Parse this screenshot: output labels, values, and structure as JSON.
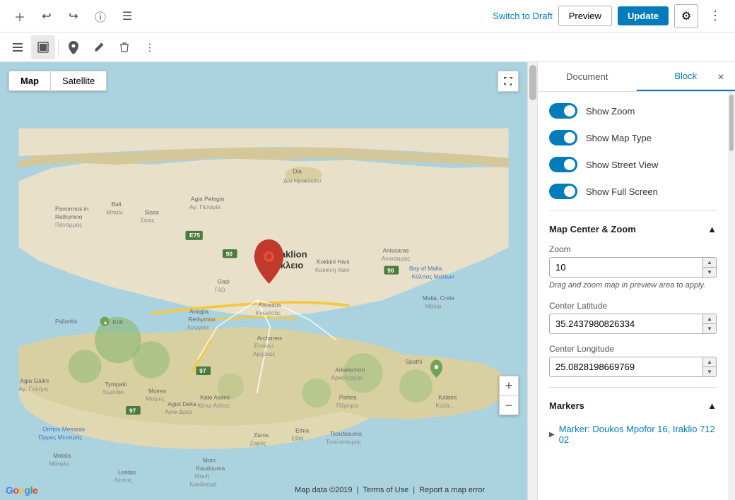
{
  "topbar": {
    "switch_draft_label": "Switch to Draft",
    "preview_label": "Preview",
    "update_label": "Update"
  },
  "block_toolbar": {
    "icons": [
      "list-view",
      "map-block",
      "marker",
      "pencil",
      "trash",
      "more"
    ]
  },
  "sidebar": {
    "doc_tab": "Document",
    "block_tab": "Block",
    "close_label": "×",
    "toggles": [
      {
        "label": "Show Zoom",
        "enabled": true
      },
      {
        "label": "Show Map Type",
        "enabled": true
      },
      {
        "label": "Show Street View",
        "enabled": true
      },
      {
        "label": "Show Full Screen",
        "enabled": true
      }
    ],
    "map_center_zoom_title": "Map Center & Zoom",
    "zoom_label": "Zoom",
    "zoom_value": "10",
    "zoom_hint": "Drag and zoom map in preview area to apply.",
    "center_lat_label": "Center Latitude",
    "center_lat_value": "35.2437980826334",
    "center_lng_label": "Center Longitude",
    "center_lng_value": "25.0828198669769",
    "markers_title": "Markers",
    "marker_item": "Marker: Doukos Mpofor 16, Iraklio 712 02"
  },
  "map": {
    "type_map": "Map",
    "type_satellite": "Satellite",
    "attribution": "Map data ©2019",
    "terms": "Terms of Use",
    "report": "Report a map error",
    "google_logo": "Google"
  }
}
